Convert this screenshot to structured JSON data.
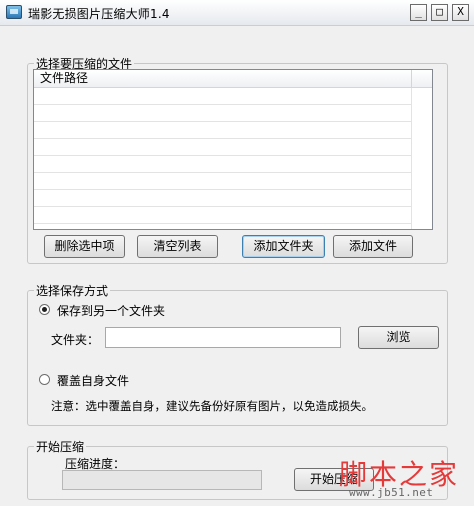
{
  "window": {
    "title": "瑞影无损图片压缩大师1.4",
    "controls": {
      "minimize": "_",
      "maximize": "□",
      "close": "X"
    }
  },
  "files_group": {
    "legend": "选择要压缩的文件",
    "list_header": "文件路径",
    "buttons": {
      "remove_selected": "删除选中项",
      "clear_list": "清空列表",
      "add_folder": "添加文件夹",
      "add_file": "添加文件"
    }
  },
  "save_group": {
    "legend": "选择保存方式",
    "option_save_to_folder": "保存到另一个文件夹",
    "folder_label": "文件夹：",
    "folder_value": "",
    "browse": "浏览",
    "option_overwrite": "覆盖自身文件",
    "note": "注意：选中覆盖自身，建议先备份好原有图片，以免造成损失。"
  },
  "compress_group": {
    "legend": "开始压缩",
    "progress_label": "压缩进度：",
    "progress_percent": 0,
    "start": "开始压缩"
  },
  "watermark": {
    "main": "脚本之家",
    "url": "www.jb51.net"
  },
  "colors": {
    "watermark_red": "#e53a3a",
    "progress_fill": "#2fb24c"
  }
}
